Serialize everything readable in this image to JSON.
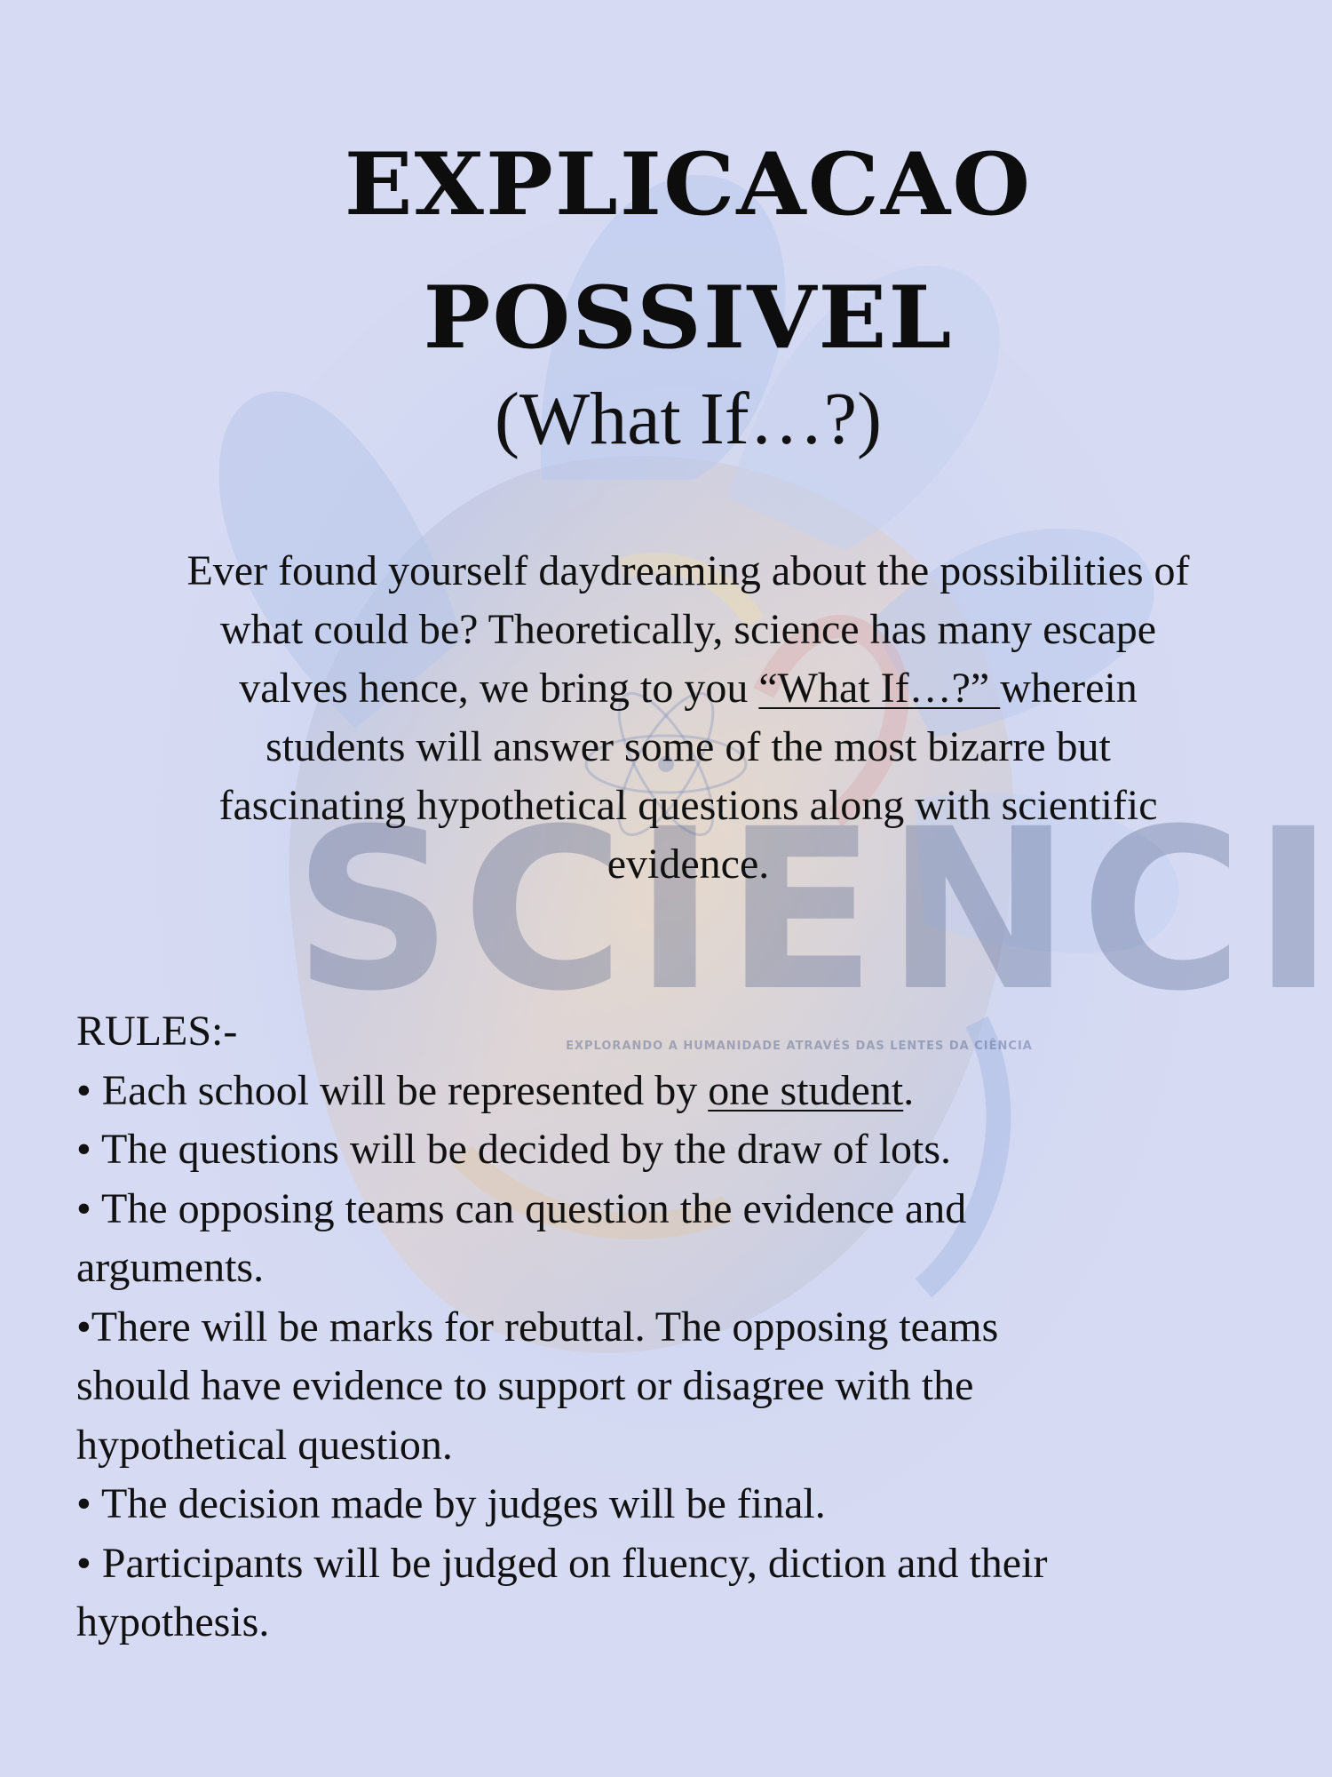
{
  "title": {
    "line1": "EXPLICACAO",
    "line2": "POSSIVEL",
    "subtitle": "(What If…?)"
  },
  "intro": {
    "line1": "Ever found yourself daydreaming about the possibilities of",
    "line2": "what could be? Theoretically, science has many escape",
    "line3_pre": "valves  hence, we bring to you ",
    "line3_link": "“What If…?” ",
    "line3_post": "wherein",
    "line4": "students will answer some of the most bizarre but",
    "line5": "fascinating hypothetical questions along with scientific",
    "line6": "evidence."
  },
  "rules": {
    "heading": "RULES:-",
    "r1_pre": "•  Each school will be represented by ",
    "r1_underline": "one student",
    "r1_post": ".",
    "r2": "•  The questions will be decided by the draw of lots.",
    "r3_a": "•  The opposing teams can question the evidence and",
    "r3_b": "arguments.",
    "r4_a": "•There will be marks for rebuttal. The opposing teams",
    "r4_b": "should have evidence to support or disagree with the",
    "r4_c": "hypothetical question.",
    "r5": "•  The decision made by judges will be final.",
    "r6_a": "•  Participants will be judged on fluency, diction and  their",
    "r6_b": "hypothesis."
  },
  "watermark": {
    "logo_text": "SCIENCIA",
    "tagline": "EXPLORANDO A HUMANIDADE ATRAVÉS DAS LENTES DA CIÊNCIA"
  },
  "colors": {
    "background": "#d6dbf3",
    "text": "#111111"
  }
}
